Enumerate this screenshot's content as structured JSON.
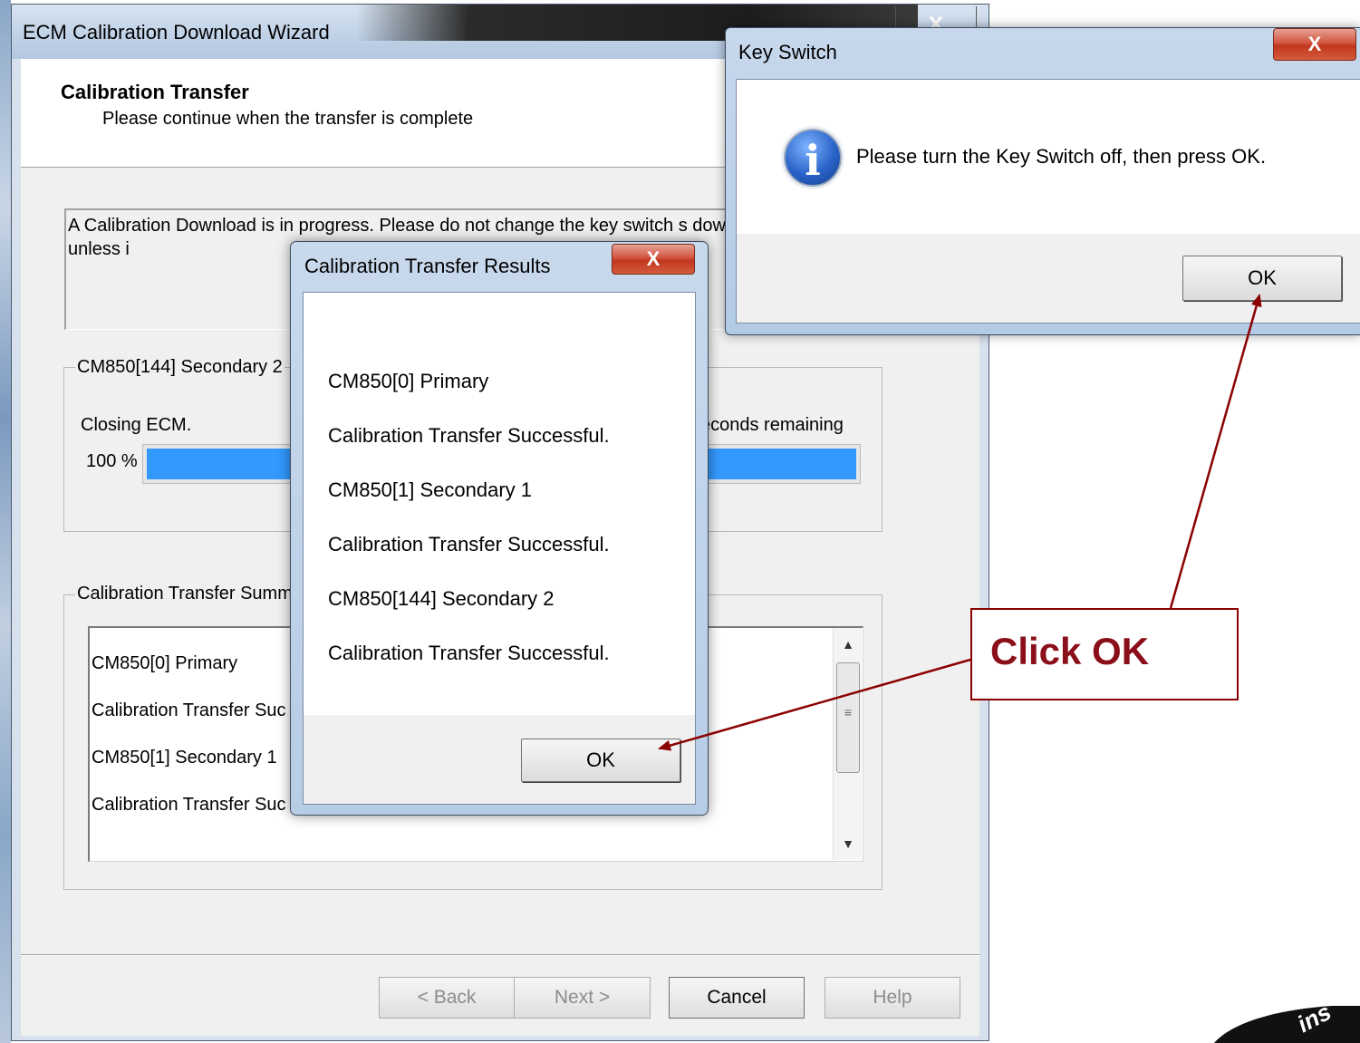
{
  "wizard": {
    "title": "ECM Calibration Download Wizard",
    "close_glyph": "x",
    "header_title": "Calibration Transfer",
    "header_subtitle": "Please continue when the transfer is complete",
    "info_text": "A Calibration Download is in progress.  Please do not change the key switch s download process unless i",
    "group1_label": "CM850[144] Secondary 2",
    "status_text": "Closing ECM.",
    "seconds_remaining": "seconds remaining",
    "progress_percent_label": "100 %",
    "progress_value": 100,
    "group2_label": "Calibration Transfer Summ",
    "summary_lines": [
      "CM850[0] Primary",
      "Calibration Transfer Suc",
      "CM850[1] Secondary 1",
      "Calibration Transfer Suc"
    ],
    "buttons": {
      "back": "< Back",
      "next": "Next >",
      "cancel": "Cancel",
      "help": "Help"
    }
  },
  "results_dialog": {
    "title": "Calibration Transfer Results",
    "close_glyph": "X",
    "lines": [
      "CM850[0] Primary",
      "Calibration Transfer Successful.",
      "CM850[1] Secondary 1",
      "Calibration Transfer Successful.",
      "CM850[144] Secondary 2",
      "Calibration Transfer Successful."
    ],
    "ok_label": "OK"
  },
  "key_switch_dialog": {
    "title": "Key Switch",
    "close_glyph": "X",
    "icon": "info-icon",
    "icon_glyph": "i",
    "message": "Please turn the Key Switch off, then press OK.",
    "ok_label": "OK"
  },
  "callout": {
    "text": "Click OK",
    "color": "#8b0f1a"
  },
  "logo": {
    "text": "ins"
  },
  "colors": {
    "progress": "#3399ff",
    "callout_border": "#8b0000",
    "arrow": "#8b0000"
  }
}
